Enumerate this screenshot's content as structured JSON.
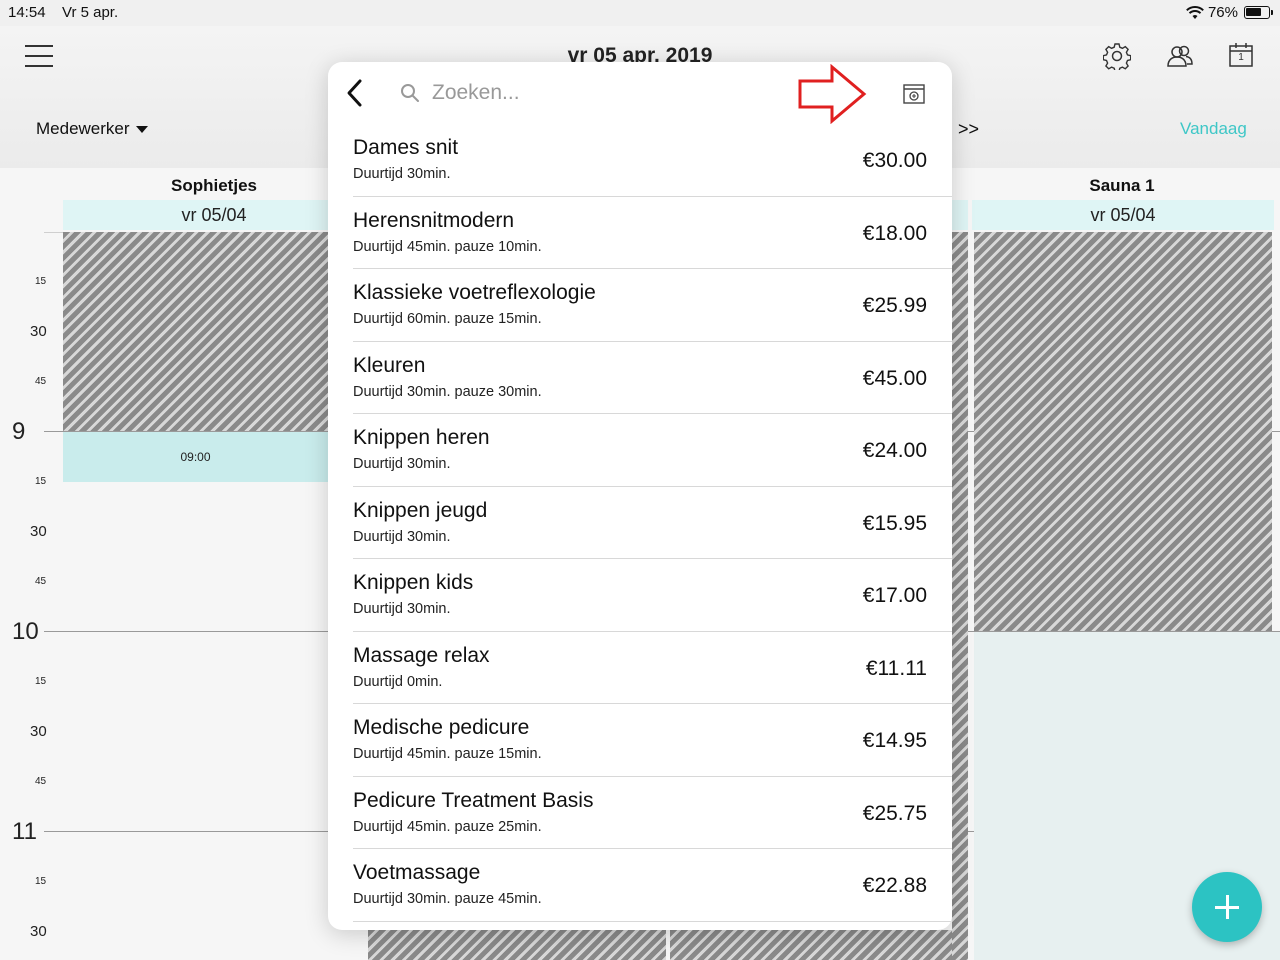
{
  "status_bar": {
    "time": "14:54",
    "date": "Vr 5 apr.",
    "battery": "76%",
    "battery_level": 0.76
  },
  "header": {
    "title": "vr 05 apr. 2019",
    "employee_filter": "Medewerker",
    "next_nav": ">>",
    "today_button": "Vandaag",
    "icons": [
      "menu-icon",
      "gear-icon",
      "users-icon",
      "calendar-icon"
    ],
    "calendar_icon_day": "1"
  },
  "calendar": {
    "columns": [
      {
        "name": "Sophietjes",
        "date": "vr 05/04"
      },
      {
        "name": "Sauna  1",
        "date": "vr 05/04"
      }
    ],
    "appointment_time": "09:00",
    "time_labels": [
      "15",
      "30",
      "45",
      "9",
      "15",
      "30",
      "45",
      "10",
      "15",
      "30",
      "45",
      "11",
      "15",
      "30"
    ]
  },
  "popup": {
    "search_placeholder": "Zoeken...",
    "services": [
      {
        "name": "Dames snit",
        "duration": "Duurtijd 30min.",
        "price": "€30.00"
      },
      {
        "name": "Herensnitmodern",
        "duration": "Duurtijd 45min. pauze 10min.",
        "price": "€18.00"
      },
      {
        "name": "Klassieke voetreflexologie",
        "duration": "Duurtijd 60min. pauze 15min.",
        "price": "€25.99"
      },
      {
        "name": "Kleuren",
        "duration": "Duurtijd 30min. pauze 30min.",
        "price": "€45.00"
      },
      {
        "name": "Knippen heren",
        "duration": "Duurtijd 30min.",
        "price": "€24.00"
      },
      {
        "name": "Knippen jeugd",
        "duration": "Duurtijd 30min.",
        "price": "€15.95"
      },
      {
        "name": "Knippen kids",
        "duration": "Duurtijd 30min.",
        "price": "€17.00"
      },
      {
        "name": "Massage relax",
        "duration": "Duurtijd 0min.",
        "price": "€11.11"
      },
      {
        "name": "Medische pedicure",
        "duration": "Duurtijd 45min. pauze 15min.",
        "price": "€14.95"
      },
      {
        "name": "Pedicure Treatment Basis",
        "duration": "Duurtijd 45min. pauze 25min.",
        "price": "€25.75"
      },
      {
        "name": "Voetmassage",
        "duration": "Duurtijd 30min. pauze 45min.",
        "price": "€22.88"
      }
    ]
  },
  "colors": {
    "accent": "#2cc3c3",
    "today_link": "#3ec7c7",
    "annotation_arrow": "#e02020"
  }
}
